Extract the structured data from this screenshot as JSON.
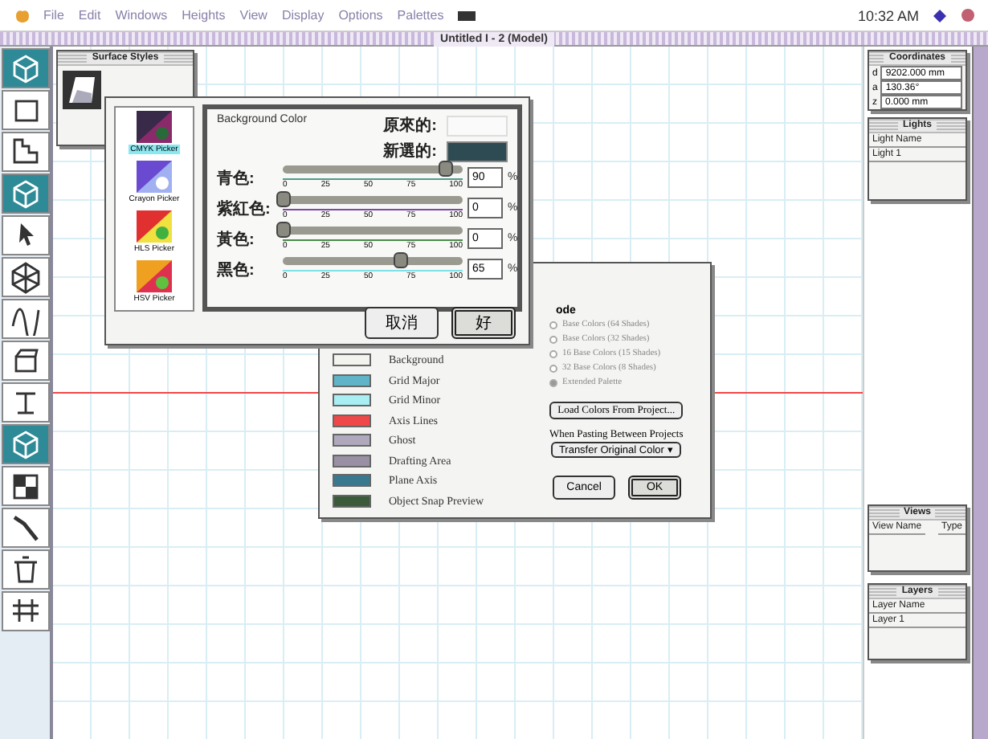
{
  "menu_bar": {
    "items": [
      "File",
      "Edit",
      "Windows",
      "Heights",
      "View",
      "Display",
      "Options",
      "Palettes"
    ],
    "clock": "10:32 AM"
  },
  "window": {
    "title": "Untitled I - 2 (Model)"
  },
  "tools": [
    {
      "kind": "cube",
      "selected": true
    },
    {
      "kind": "rect",
      "selected": false
    },
    {
      "kind": "stairs",
      "selected": false
    },
    {
      "kind": "cube",
      "selected": true
    },
    {
      "kind": "pointer",
      "selected": false
    },
    {
      "kind": "frame",
      "selected": false
    },
    {
      "kind": "wave",
      "selected": false
    },
    {
      "kind": "box",
      "selected": false
    },
    {
      "kind": "stand",
      "selected": false
    },
    {
      "kind": "cube",
      "selected": true
    },
    {
      "kind": "checker",
      "selected": false
    },
    {
      "kind": "line",
      "selected": false
    },
    {
      "kind": "trash",
      "selected": false
    },
    {
      "kind": "grid",
      "selected": false
    }
  ],
  "surface_styles": {
    "title": "Surface Styles"
  },
  "color_picker": {
    "pickers": [
      {
        "label": "CMYK Picker",
        "selected": true
      },
      {
        "label": "Crayon Picker",
        "selected": false
      },
      {
        "label": "HLS Picker",
        "selected": false
      },
      {
        "label": "HSV Picker",
        "selected": false
      }
    ],
    "heading": "Background Color",
    "original_label": "原來的:",
    "new_label": "新選的:",
    "new_swatch": {
      "color": "#2e4a52"
    },
    "channels": [
      {
        "name": "青色:",
        "level": 0.9,
        "value": "90",
        "unit": "%",
        "color": "#4f9a8a",
        "ticks": [
          "0",
          "25",
          "50",
          "75",
          "100"
        ]
      },
      {
        "name": "紫紅色:",
        "level": 0,
        "value": "0",
        "unit": "%",
        "color": "#7a4aa8",
        "ticks": [
          "0",
          "25",
          "50",
          "75",
          "100"
        ]
      },
      {
        "name": "黃色:",
        "level": 0,
        "value": "0",
        "unit": "%",
        "color": "#4a8a4a",
        "ticks": [
          "0",
          "25",
          "50",
          "75",
          "100"
        ]
      },
      {
        "name": "黑色:",
        "level": 0.65,
        "value": "65",
        "unit": "%",
        "color": "#7fe0e8",
        "ticks": [
          "0",
          "25",
          "50",
          "75",
          "100"
        ]
      }
    ],
    "buttons": [
      {
        "label": "取消",
        "default": false
      },
      {
        "label": "好",
        "default": true
      }
    ]
  },
  "colors_dialog": {
    "mode_heading": "ode",
    "modes": [
      {
        "label": "Base Colors (64 Shades)",
        "selected": false
      },
      {
        "label": "Base Colors (32 Shades)",
        "selected": false
      },
      {
        "label": "16 Base Colors (15 Shades)",
        "selected": false
      },
      {
        "label": "32 Base Colors (8 Shades)",
        "selected": false
      },
      {
        "label": "Extended Palette",
        "selected": true
      }
    ],
    "items": [
      {
        "label": "Background",
        "color": "#f4f4ee"
      },
      {
        "label": "Grid Major",
        "color": "#5fb4c8"
      },
      {
        "label": "Grid Minor",
        "color": "#a8eef2"
      },
      {
        "label": "Axis Lines",
        "color": "#f04848"
      },
      {
        "label": "Ghost",
        "color": "#b0a8bc"
      },
      {
        "label": "Drafting Area",
        "color": "#9a90a4"
      },
      {
        "label": "Plane Axis",
        "color": "#3a7890"
      },
      {
        "label": "Object Snap Preview",
        "color": "#3a5a3a"
      }
    ],
    "load_button": "Load Colors From Project...",
    "paste_label": "When Pasting Between Projects",
    "paste_value": "Transfer Original Color",
    "paste_arrow": "▾",
    "cancel": "Cancel",
    "ok": "OK"
  },
  "coordinates": {
    "title": "Coordinates",
    "rows": [
      {
        "axis": "d",
        "value": "9202.000 mm"
      },
      {
        "axis": "a",
        "value": "130.36°"
      },
      {
        "axis": "z",
        "value": "0.000 mm"
      }
    ]
  },
  "lights": {
    "title": "Lights",
    "column": "Light Name",
    "rows": [
      "Light 1"
    ]
  },
  "views": {
    "title": "Views",
    "columns": [
      "View Name",
      "Type"
    ]
  },
  "layers": {
    "title": "Layers",
    "column": "Layer Name",
    "rows": [
      "Layer 1"
    ]
  }
}
